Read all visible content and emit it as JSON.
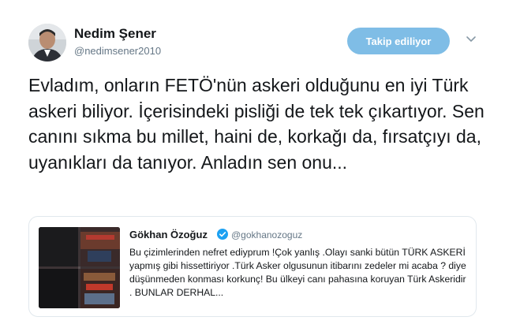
{
  "author": {
    "name": "Nedim Şener",
    "handle": "@nedimsener2010",
    "avatar": "avatar-photo"
  },
  "follow_button": {
    "label": "Takip ediliyor",
    "color": "#7fbde6"
  },
  "menu": {
    "icon": "chevron-down-icon"
  },
  "tweet": {
    "text": "Evladım, onların FETÖ'nün askeri olduğunu en iyi Türk askeri biliyor. İçerisindeki pisliği de tek tek çıkartıyor. Sen canını sıkma bu millet, haini de, korkağı da, fırsatçıyı da, uyanıkları da tanıyor. Anladın sen onu..."
  },
  "quoted_tweet": {
    "author_name": "Gökhan Özoğuz",
    "verified_icon": "verified-badge-icon",
    "handle": "@gokhanozoguz",
    "text": "Bu çizimlerinden nefret ediyprum !Çok yanlış .Olayı sanki bütün TÜRK ASKERİ yapmış gibi hissettiriyor .Türk Asker olgusunun itibarını zedeler mi acaba ? diye düşünmeden konması korkunç! Bu ülkeyi canı pahasına koruyan Türk Askeridir . BUNLAR DERHAL..."
  }
}
